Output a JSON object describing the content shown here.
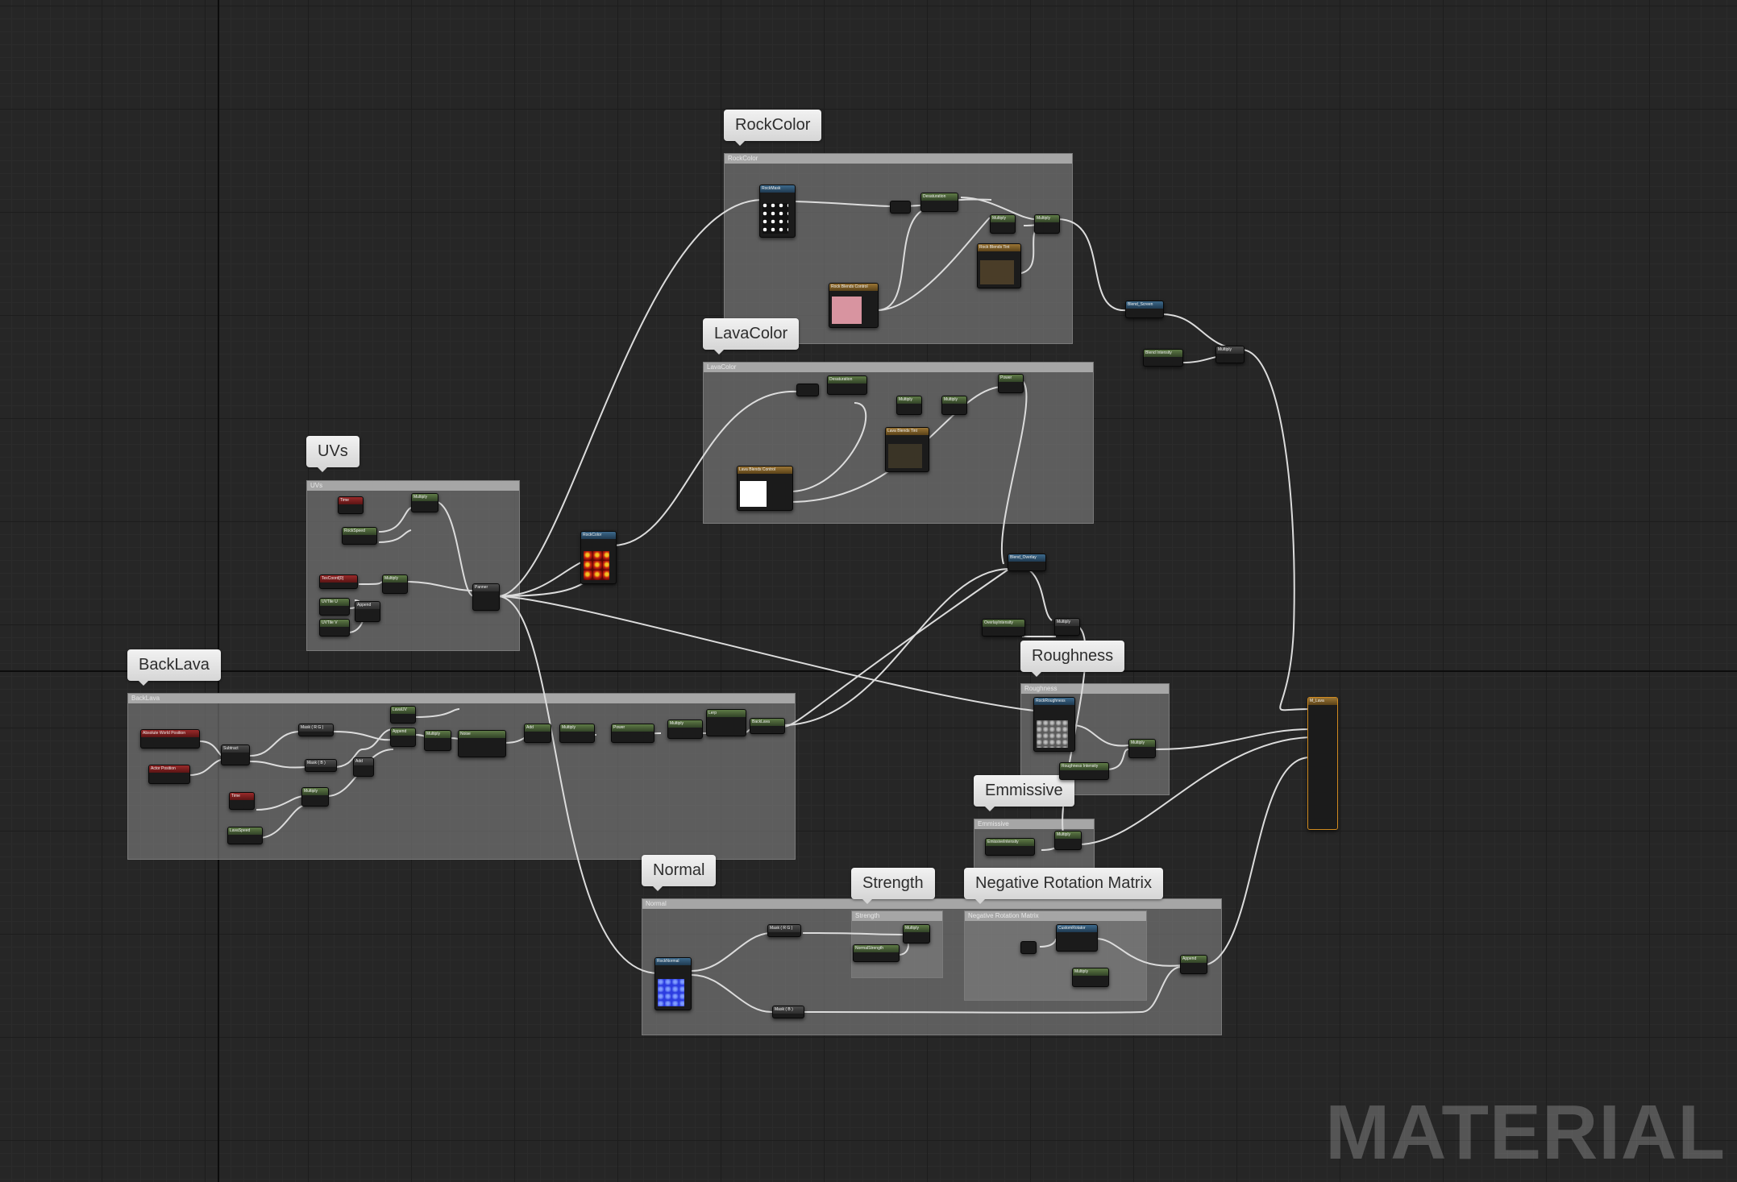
{
  "watermark": "MATERIAL",
  "colors": {
    "background": "#262626",
    "comment_box": "#808080",
    "wire": "#dcdcdc",
    "parameter_node": "#5e7a46",
    "position_node": "#9a2a2a",
    "texture_node": "#3d6a8c",
    "vector_param_node": "#9a7535",
    "main_node_outline": "#d08a20"
  },
  "comment_bubbles": {
    "rock_color": "RockColor",
    "lava_color": "LavaColor",
    "uvs": "UVs",
    "back_lava": "BackLava",
    "roughness": "Roughness",
    "emissive": "Emmissive",
    "normal": "Normal",
    "strength": "Strength",
    "negative_rotation_matrix": "Negative Rotation Matrix"
  },
  "comment_headers": {
    "rock_color": "RockColor",
    "lava_color": "LavaColor",
    "uvs": "UVs",
    "back_lava": "BackLava",
    "roughness": "Roughness",
    "emissive": "Emmissive",
    "normal": "Normal",
    "strength": "Strength",
    "negative_rotation_matrix": "Negative Rotation Matrix"
  },
  "nodes": {
    "rock_mask": "RockMask",
    "rock_color_tex": "RockColor",
    "desaturation": "Desaturation",
    "multiply": "Multiply",
    "rock_blend_tint": "Rock Blends Tint",
    "rock_blend_control": "Rock Blends Control",
    "lava_blend_tint": "Lava Blends Tint",
    "lava_blend_control": "Lava Blends Control",
    "blend_screen": "Blend_Screen",
    "blend_overlay": "Blend_Overlay",
    "blend_intensity": "Blend Intensity",
    "overlay_intensity": "OverlayIntensity",
    "time": "Time",
    "rock_speed": "RockSpeed",
    "tex_coord": "TexCoord[0]",
    "uv_tile_u": "UVTile U",
    "uv_tile_v": "UVTile V",
    "append": "Append",
    "panner": "Panner",
    "absolute_world_position": "Absolute World Position",
    "actor_position": "Actor Position",
    "subtract": "Subtract",
    "mask_rg": "Mask ( R G )",
    "mask_b": "Mask ( B )",
    "lava_uv": "LavaUV",
    "lava_speed": "LavaSpeed",
    "noise": "Noise",
    "add": "Add",
    "power": "Power",
    "lerp": "Lerp",
    "back_lava": "BackLava",
    "rock_roughness": "RockRoughness",
    "roughness_intensity": "Roughness Intensity",
    "emissive_intensity": "EmissiveIntensity",
    "rock_normal": "RockNormal",
    "normal_strength": "NormalStrength",
    "custom_rotator": "CustomRotator",
    "main_material": "M_Lava"
  }
}
